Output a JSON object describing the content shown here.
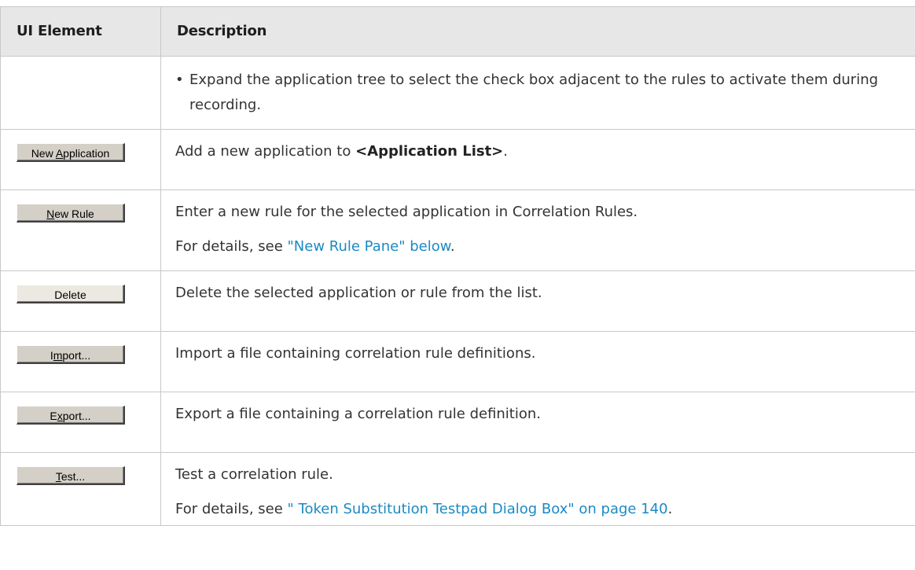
{
  "header": {
    "col1": "UI Element",
    "col2": "Description"
  },
  "rows": [
    {
      "bullet": "•",
      "text": "Expand the application tree to select the check box adjacent to the rules to activate them during recording."
    },
    {
      "button": {
        "pre": "New ",
        "mnemonic": "A",
        "post": "pplication"
      },
      "text_before": "Add a new application to ",
      "text_bold": "<Application List>",
      "text_after": "."
    },
    {
      "button": {
        "pre": "",
        "mnemonic": "N",
        "post": "ew Rule"
      },
      "text": "Enter a new rule for the selected application in Correlation Rules.",
      "details_prefix": "For details, see ",
      "details_link": "\"New Rule Pane\" below",
      "details_suffix": "."
    },
    {
      "button": {
        "pre": "Delete",
        "mnemonic": "",
        "post": ""
      },
      "text": "Delete the selected application or rule from the list."
    },
    {
      "button": {
        "pre": "I",
        "mnemonic": "m",
        "post": "port..."
      },
      "text": "Import a file containing correlation rule definitions."
    },
    {
      "button": {
        "pre": "E",
        "mnemonic": "x",
        "post": "port..."
      },
      "text": "Export a file containing a correlation rule definition."
    },
    {
      "button": {
        "pre": "",
        "mnemonic": "T",
        "post": "est..."
      },
      "text": "Test a correlation rule.",
      "details_prefix": "For details, see ",
      "details_link": "\" Token Substitution Testpad Dialog Box\" on page 140",
      "details_suffix": "."
    }
  ]
}
